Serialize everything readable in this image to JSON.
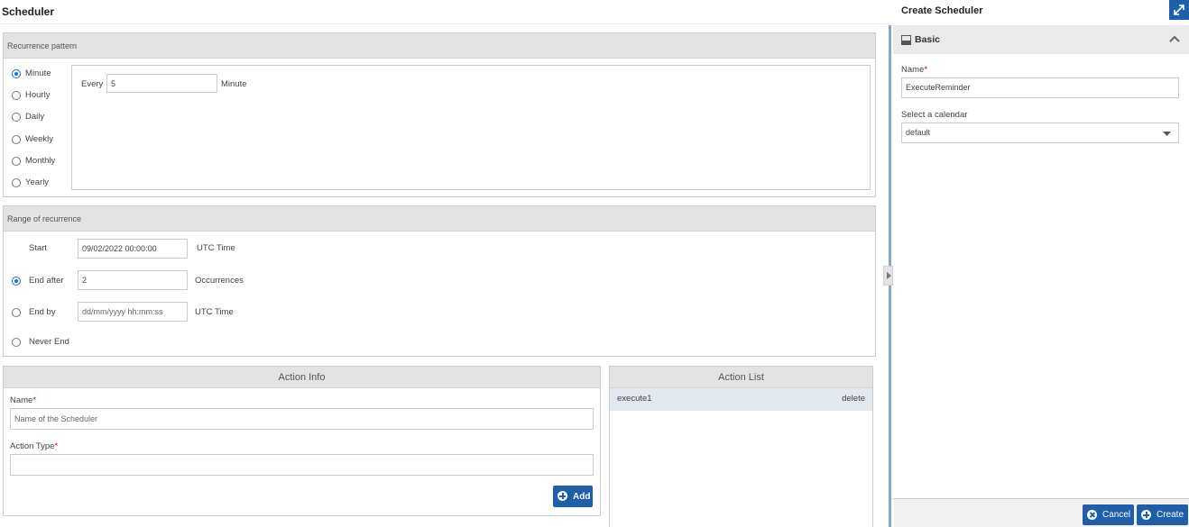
{
  "app": {
    "title": "Scheduler"
  },
  "recurrence_pattern": {
    "header": "Recurrence pattern",
    "options": [
      "Minute",
      "Hourly",
      "Daily",
      "Weekly",
      "Monthly",
      "Yearly"
    ],
    "selected": "Minute",
    "every_label": "Every",
    "every_value": "5",
    "unit_label": "Minute"
  },
  "range_of_recurrence": {
    "header": "Range of recurrence",
    "start_label": "Start",
    "start_value": "09/02/2022 00:00:00",
    "start_unit": "UTC Time",
    "end_after_label": "End after",
    "end_after_value": "2",
    "end_after_unit": "Occurrences",
    "end_by_label": "End by",
    "end_by_placeholder": "dd/mm/yyyy hh:mm:ss",
    "end_by_unit": "UTC Time",
    "never_end_label": "Never End",
    "selected": "End after"
  },
  "action_info": {
    "header": "Action Info",
    "name_label": "Name",
    "name_placeholder": "Name of the Scheduler",
    "action_type_label": "Action Type",
    "action_type_value": "",
    "add_label": "Add"
  },
  "action_list": {
    "header": "Action List",
    "items": [
      {
        "name": "execute1",
        "action": "delete"
      }
    ]
  },
  "create_panel": {
    "title": "Create Scheduler",
    "section": "Basic",
    "name_label": "Name",
    "name_value": "ExecuteReminder",
    "calendar_label": "Select a calendar",
    "calendar_value": "default",
    "cancel_label": "Cancel",
    "create_label": "Create"
  },
  "colors": {
    "accent": "#1f5ea8",
    "radio_selected": "#1a73c8",
    "header_bg": "#e3e3e3",
    "required": "#cc0000"
  }
}
